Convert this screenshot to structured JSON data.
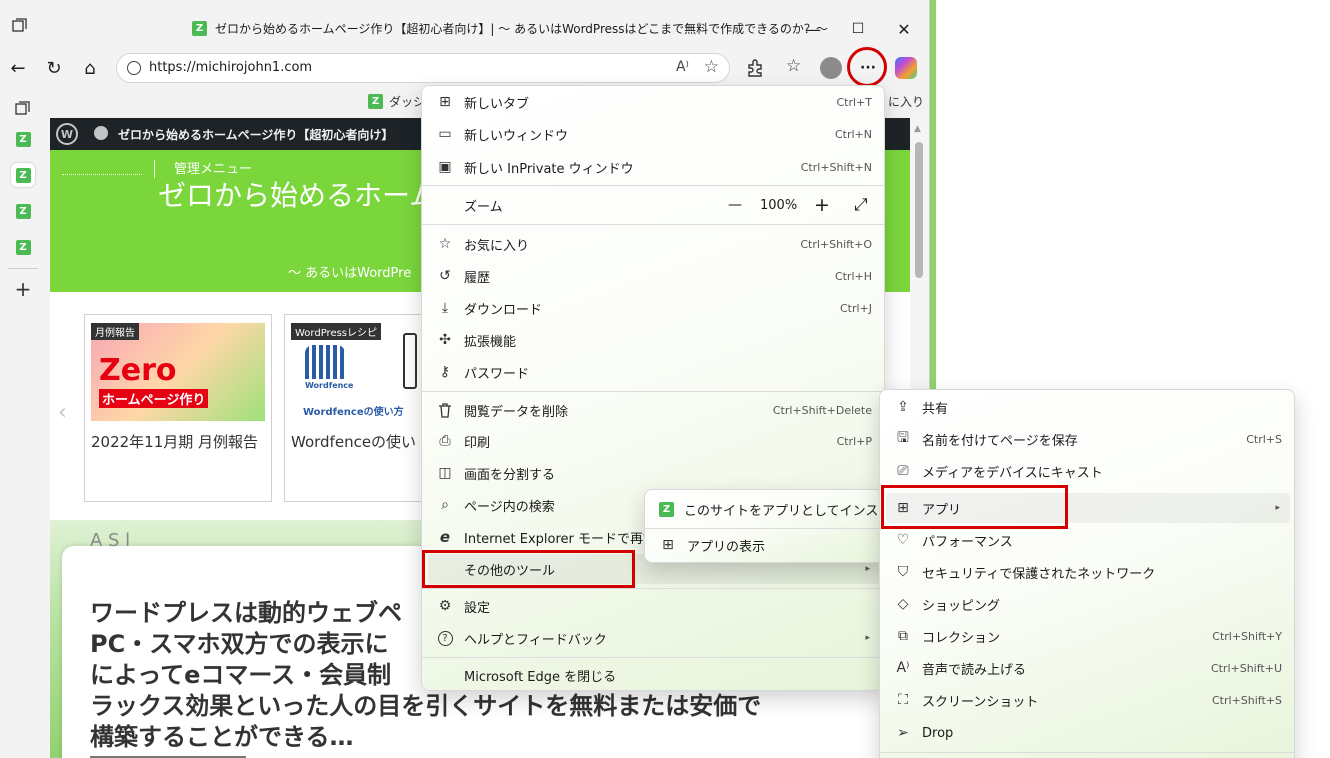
{
  "window": {
    "title": "ゼロから始めるホームページ作り【超初心者向け】| 〜 あるいはWordPressはどこまで無料で作成できるのか？〜",
    "favicon_letter": "Z",
    "controls": {
      "minimize": "—",
      "maximize": "☐",
      "close": "✕"
    }
  },
  "toolbar": {
    "back": "←",
    "refresh": "↻",
    "home": "⌂",
    "url": "https://michirojohn1.com",
    "read_aloud": "A⁾",
    "favorite": "☆",
    "more": "···"
  },
  "favorites_bar": {
    "left_label": "ダッシ",
    "right_label": "に入り"
  },
  "page": {
    "admin_bar_site": "ゼロから始めるホームページ作り【超初心者向け】",
    "hero_menu_label": "管理メニュー",
    "hero_title": "ゼロから始めるホーム",
    "hero_subtitle": "〜 あるいはWordPre",
    "cards": [
      {
        "badge": "月例報告",
        "title": "2022年11月期 月例報告",
        "thumb_text": "Zero",
        "thumb_sub": "ホームページ作り"
      },
      {
        "badge": "WordPressレシピ",
        "title": "Wordfenceの使い",
        "thumb_text": "Wordfence",
        "thumb_sub": "Wordfenceの使い方"
      }
    ],
    "article_peek": "A    S    l",
    "article_heading": "ワードプレスは動的ウェブペ\nPC・スマホ双方での表示に\nによってeコマース・会員制\nラックス効果といった人の目を引くサイトを無料または安価で\n構築することができる…",
    "carousel_prev": "‹"
  },
  "main_menu": {
    "items": [
      {
        "label": "新しいタブ",
        "shortcut": "Ctrl+T",
        "icon": "new-tab-icon",
        "glyph": "⊞"
      },
      {
        "label": "新しいウィンドウ",
        "shortcut": "Ctrl+N",
        "icon": "window-icon",
        "glyph": "▭"
      },
      {
        "label": "新しい InPrivate ウィンドウ",
        "shortcut": "Ctrl+Shift+N",
        "icon": "inprivate-icon",
        "glyph": "▣"
      },
      {
        "label": "ズーム",
        "icon": "zoom-icon",
        "glyph": ""
      },
      {
        "label": "お気に入り",
        "shortcut": "Ctrl+Shift+O",
        "icon": "favorites-icon",
        "glyph": "☆"
      },
      {
        "label": "履歴",
        "shortcut": "Ctrl+H",
        "icon": "history-icon",
        "glyph": "↺"
      },
      {
        "label": "ダウンロード",
        "shortcut": "Ctrl+J",
        "icon": "download-icon",
        "glyph": "⤓"
      },
      {
        "label": "拡張機能",
        "icon": "extensions-icon",
        "glyph": "✣"
      },
      {
        "label": "パスワード",
        "icon": "key-icon",
        "glyph": "⚷"
      },
      {
        "label": "閲覧データを削除",
        "shortcut": "Ctrl+Shift+Delete",
        "icon": "trash-icon",
        "glyph": "🗑"
      },
      {
        "label": "印刷",
        "shortcut": "Ctrl+P",
        "icon": "print-icon",
        "glyph": "⎙"
      },
      {
        "label": "画面を分割する",
        "icon": "split-screen-icon",
        "glyph": "◫"
      },
      {
        "label": "ページ内の検索",
        "icon": "find-icon",
        "glyph": "⌕"
      },
      {
        "label": "Internet Explorer モードで再読み",
        "icon": "ie-icon",
        "glyph": "e"
      },
      {
        "label": "その他のツール",
        "icon": "more-tools-icon",
        "glyph": ""
      },
      {
        "label": "設定",
        "icon": "settings-icon",
        "glyph": "⚙"
      },
      {
        "label": "ヘルプとフィードバック",
        "icon": "help-icon",
        "glyph": "?"
      },
      {
        "label": "Microsoft Edge を閉じる",
        "icon": "close-edge-icon",
        "glyph": ""
      }
    ],
    "zoom": {
      "minus": "—",
      "value": "100%",
      "plus": "+",
      "fullscreen": "⤢"
    },
    "submenu_arrow": "▸"
  },
  "apps_submenu": {
    "items": [
      {
        "label": "このサイトをアプリとしてインストール",
        "icon": "install-site-icon"
      },
      {
        "label": "アプリの表示",
        "icon": "apps-view-icon",
        "glyph": "⊞"
      }
    ]
  },
  "more_tools_menu": {
    "items": [
      {
        "label": "共有",
        "icon": "share-icon",
        "glyph": "⇪"
      },
      {
        "label": "名前を付けてページを保存",
        "shortcut": "Ctrl+S",
        "icon": "save-icon",
        "glyph": "🖫"
      },
      {
        "label": "メディアをデバイスにキャスト",
        "icon": "cast-icon",
        "glyph": "⎚"
      },
      {
        "label": "アプリ",
        "icon": "apps-icon",
        "glyph": "⊞"
      },
      {
        "label": "パフォーマンス",
        "icon": "performance-icon",
        "glyph": "♡"
      },
      {
        "label": "セキュリティで保護されたネットワーク",
        "icon": "shield-icon",
        "glyph": "⛉"
      },
      {
        "label": "ショッピング",
        "icon": "tag-icon",
        "glyph": "◇"
      },
      {
        "label": "コレクション",
        "shortcut": "Ctrl+Shift+Y",
        "icon": "collections-icon",
        "glyph": "⧉"
      },
      {
        "label": "音声で読み上げる",
        "shortcut": "Ctrl+Shift+U",
        "icon": "read-aloud-icon",
        "glyph": "A⁾"
      },
      {
        "label": "スクリーンショット",
        "shortcut": "Ctrl+Shift+S",
        "icon": "screenshot-icon",
        "glyph": "⛶"
      },
      {
        "label": "Drop",
        "icon": "drop-icon",
        "glyph": "➢"
      }
    ]
  },
  "colors": {
    "accent_red": "#d40000",
    "hero_green": "#7bd63c",
    "admin_bar": "#1d2327",
    "favicon_green": "#4cba54"
  }
}
